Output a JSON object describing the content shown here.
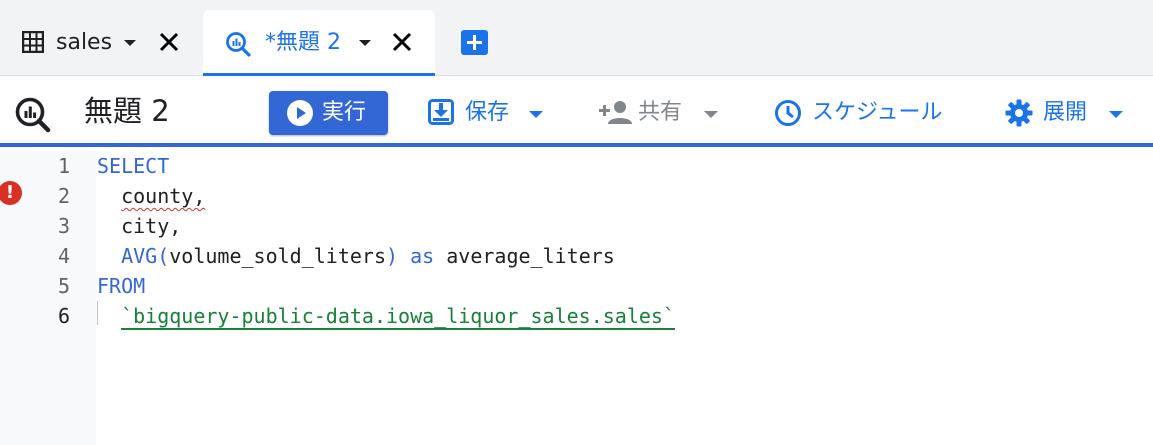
{
  "tabs": [
    {
      "label": "sales",
      "icon": "table-icon"
    },
    {
      "label": "*無題 2",
      "icon": "query-icon",
      "active": true
    }
  ],
  "toolbar": {
    "title": "無題 2",
    "run_label": "実行",
    "save_label": "保存",
    "share_label": "共有",
    "schedule_label": "スケジュール",
    "deploy_label": "展開"
  },
  "editor": {
    "line_numbers": [
      "1",
      "2",
      "3",
      "4",
      "5",
      "6"
    ],
    "current_line": "6",
    "error_line": "2",
    "lines": {
      "l1_kw": "SELECT",
      "l2_text": "county,",
      "l3_text": "city,",
      "l4_fn": "AVG",
      "l4_paren_open": "(",
      "l4_arg": "volume_sold_liters",
      "l4_paren_close": ")",
      "l4_as": "as",
      "l4_alias": "average_liters",
      "l5_kw": "FROM",
      "l6_table": "`bigquery-public-data.iowa_liquor_sales.sales`"
    }
  },
  "colors": {
    "accent": "#1a73e8",
    "run_button": "#3367d6",
    "keyword": "#3367d6",
    "string": "#188038",
    "error": "#d93025"
  }
}
